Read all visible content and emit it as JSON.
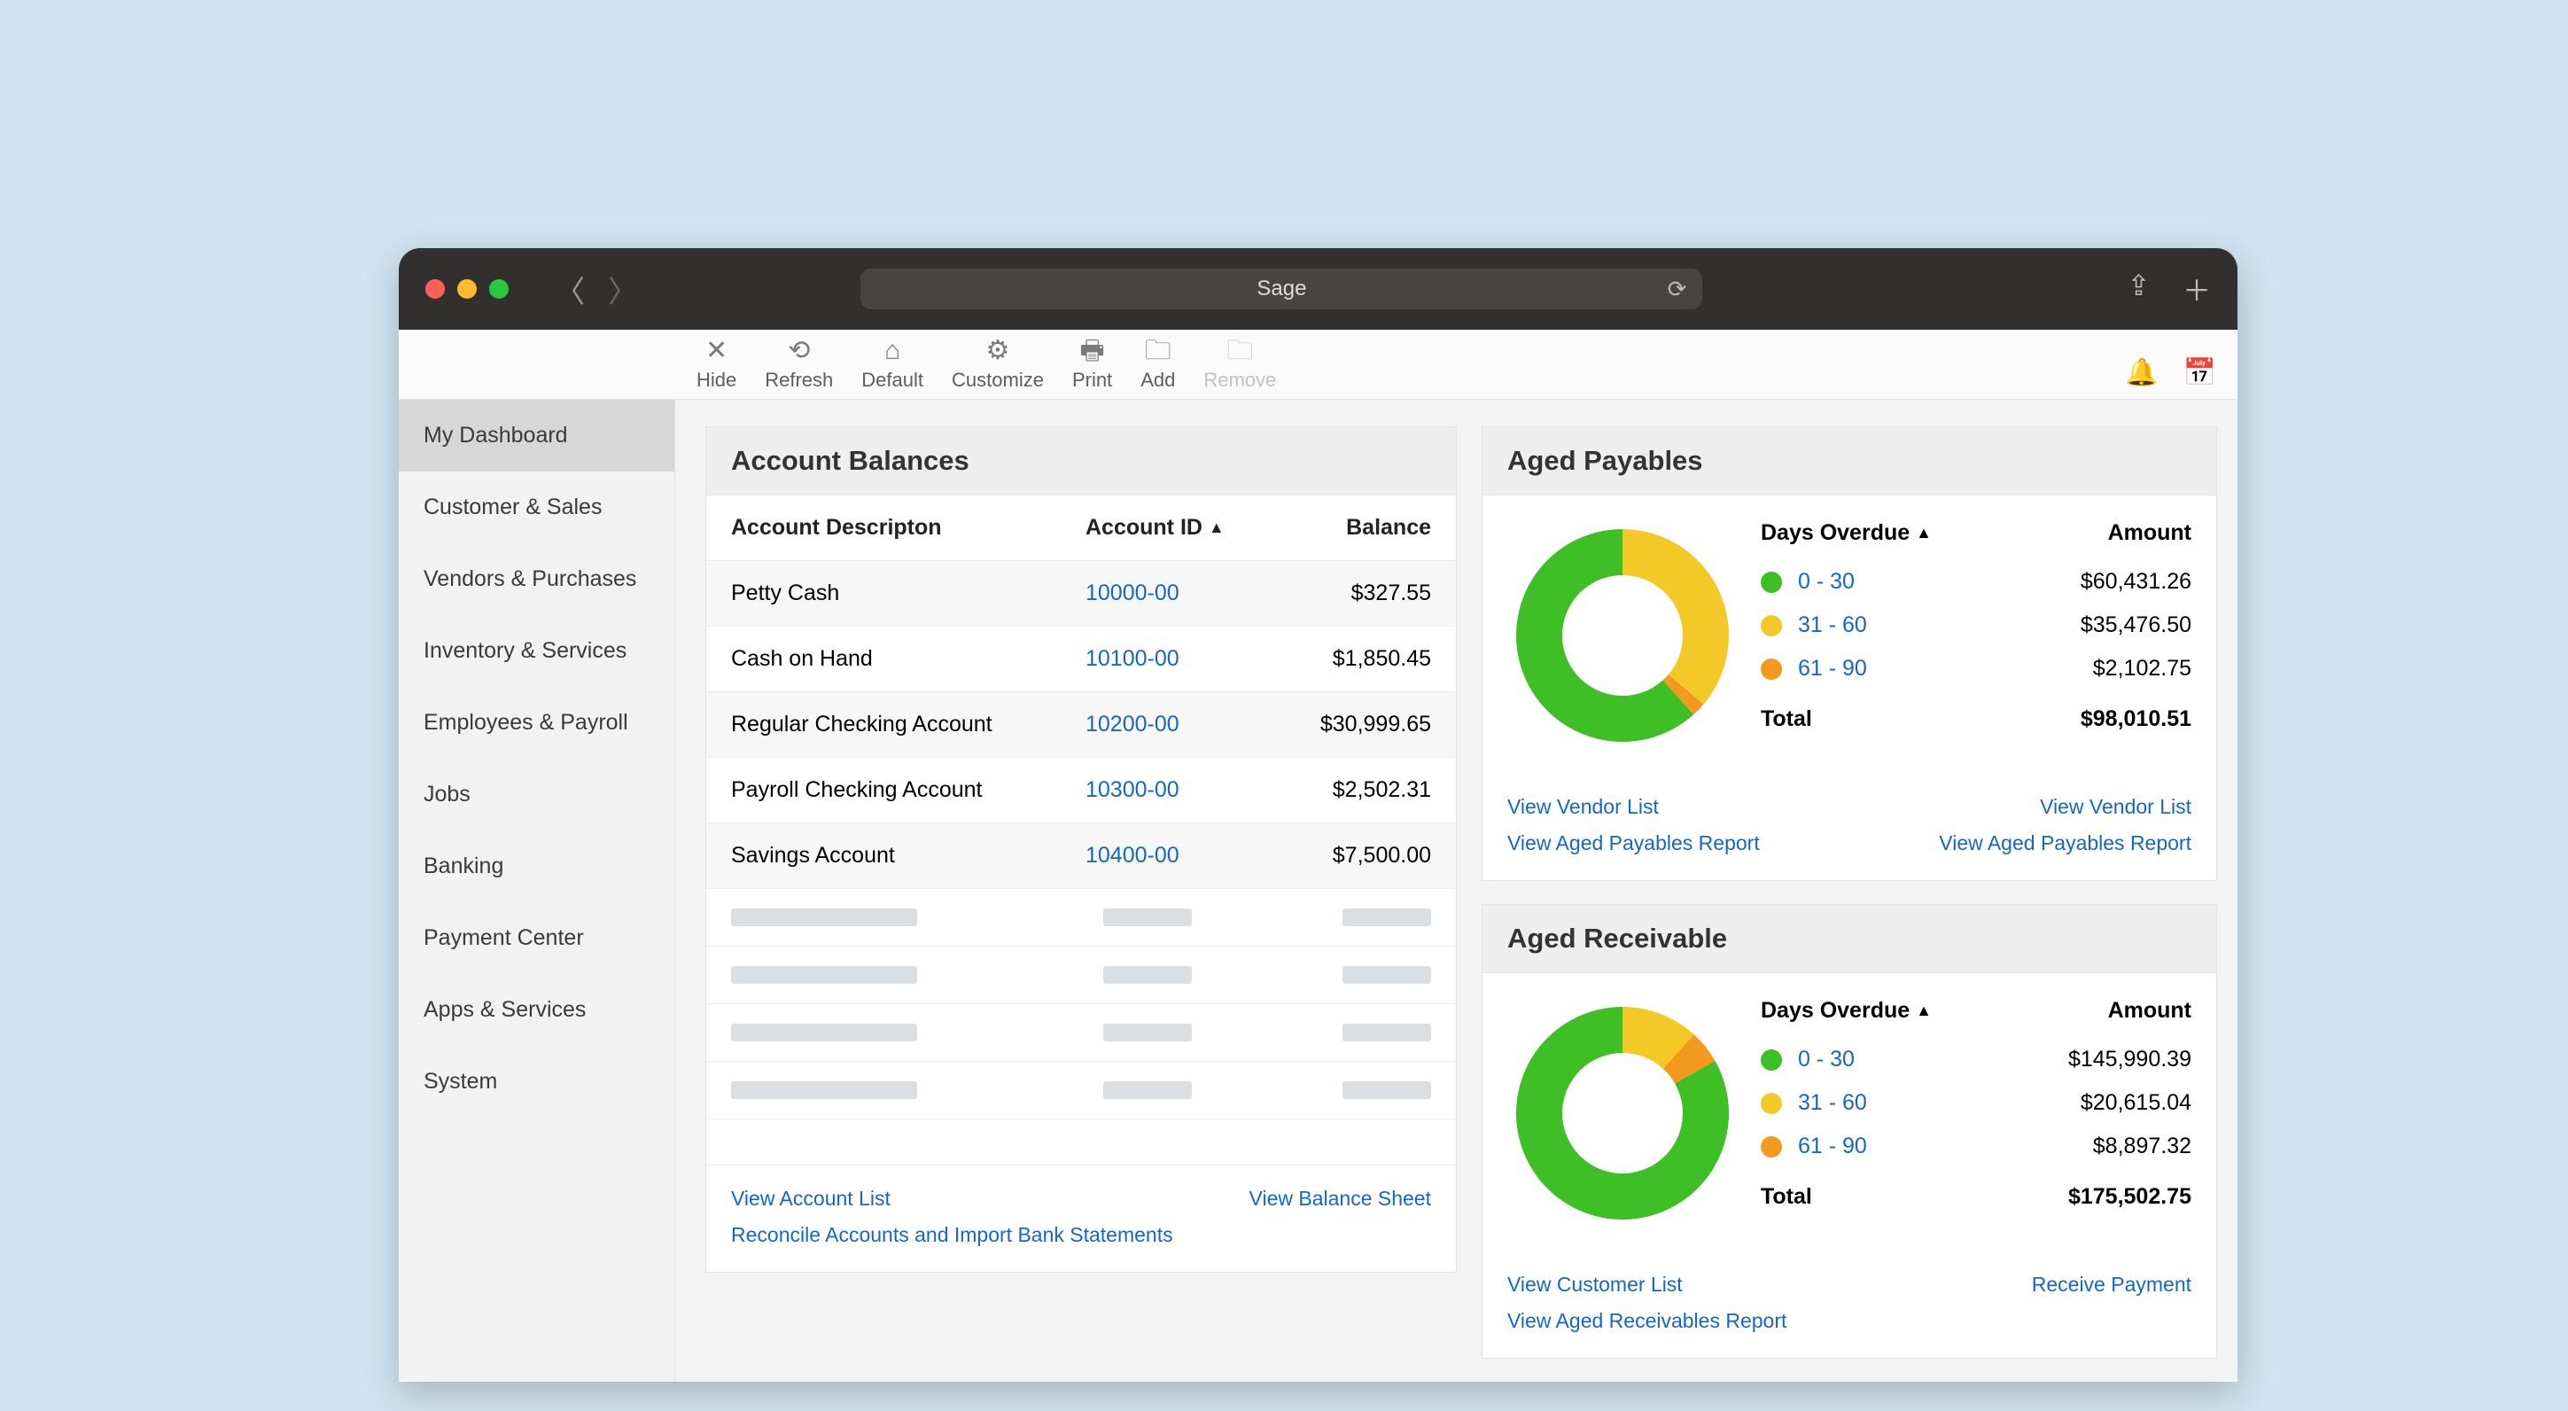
{
  "browser": {
    "title": "Sage"
  },
  "toolbar": {
    "items": [
      {
        "label": "Hide",
        "icon": "✕"
      },
      {
        "label": "Refresh",
        "icon": "⟲"
      },
      {
        "label": "Default",
        "icon": "⌂"
      },
      {
        "label": "Customize",
        "icon": "⚙"
      },
      {
        "label": "Print",
        "icon": "🖶"
      },
      {
        "label": "Add",
        "icon": "🗀"
      },
      {
        "label": "Remove",
        "icon": "🗀",
        "disabled": true
      }
    ]
  },
  "sidebar": {
    "items": [
      "My Dashboard",
      "Customer & Sales",
      "Vendors & Purchases",
      "Inventory & Services",
      "Employees & Payroll",
      "Jobs",
      "Banking",
      "Payment Center",
      "Apps & Services",
      "System"
    ],
    "active_index": 0
  },
  "account_balances": {
    "title": "Account Balances",
    "columns": {
      "desc": "Account Descripton",
      "acct": "Account ID",
      "bal": "Balance"
    },
    "rows": [
      {
        "desc": "Petty Cash",
        "id": "10000-00",
        "bal": "$327.55"
      },
      {
        "desc": "Cash on Hand",
        "id": "10100-00",
        "bal": "$1,850.45"
      },
      {
        "desc": "Regular Checking Account",
        "id": "10200-00",
        "bal": "$30,999.65"
      },
      {
        "desc": "Payroll Checking Account",
        "id": "10300-00",
        "bal": "$2,502.31"
      },
      {
        "desc": "Savings Account",
        "id": "10400-00",
        "bal": "$7,500.00"
      }
    ],
    "links": {
      "left": [
        "View Account List",
        "Reconcile Accounts and Import Bank Statements"
      ],
      "right": [
        "View Balance Sheet"
      ]
    }
  },
  "aged_payables": {
    "title": "Aged Payables",
    "header_left": "Days Overdue",
    "header_right": "Amount",
    "rows": [
      {
        "range": "0 - 30",
        "amount": "$60,431.26",
        "color": "green"
      },
      {
        "range": "31 - 60",
        "amount": "$35,476.50",
        "color": "yellow"
      },
      {
        "range": "61 - 90",
        "amount": "$2,102.75",
        "color": "orange"
      }
    ],
    "total_label": "Total",
    "total": "$98,010.51",
    "links_left": [
      "View Vendor List",
      "View Aged Payables Report"
    ],
    "links_right": [
      "View Vendor List",
      "View Aged Payables Report"
    ]
  },
  "aged_receivable": {
    "title": "Aged Receivable",
    "header_left": "Days Overdue",
    "header_right": "Amount",
    "rows": [
      {
        "range": "0 - 30",
        "amount": "$145,990.39",
        "color": "green"
      },
      {
        "range": "31 - 60",
        "amount": "$20,615.04",
        "color": "yellow"
      },
      {
        "range": "61 - 90",
        "amount": "$8,897.32",
        "color": "orange"
      }
    ],
    "total_label": "Total",
    "total": "$175,502.75",
    "links_left": [
      "View Customer List",
      "View Aged Receivables Report"
    ],
    "links_right": [
      "Receive Payment"
    ]
  },
  "chart_data": [
    {
      "type": "pie",
      "title": "Aged Payables",
      "categories": [
        "0 - 30",
        "31 - 60",
        "61 - 90"
      ],
      "values": [
        60431.26,
        35476.5,
        2102.75
      ],
      "colors": [
        "#3FBF26",
        "#F2C926",
        "#F39A1E"
      ]
    },
    {
      "type": "pie",
      "title": "Aged Receivable",
      "categories": [
        "0 - 30",
        "31 - 60",
        "61 - 90"
      ],
      "values": [
        145990.39,
        20615.04,
        8897.32
      ],
      "colors": [
        "#3FBF26",
        "#F2C926",
        "#F39A1E"
      ]
    }
  ]
}
